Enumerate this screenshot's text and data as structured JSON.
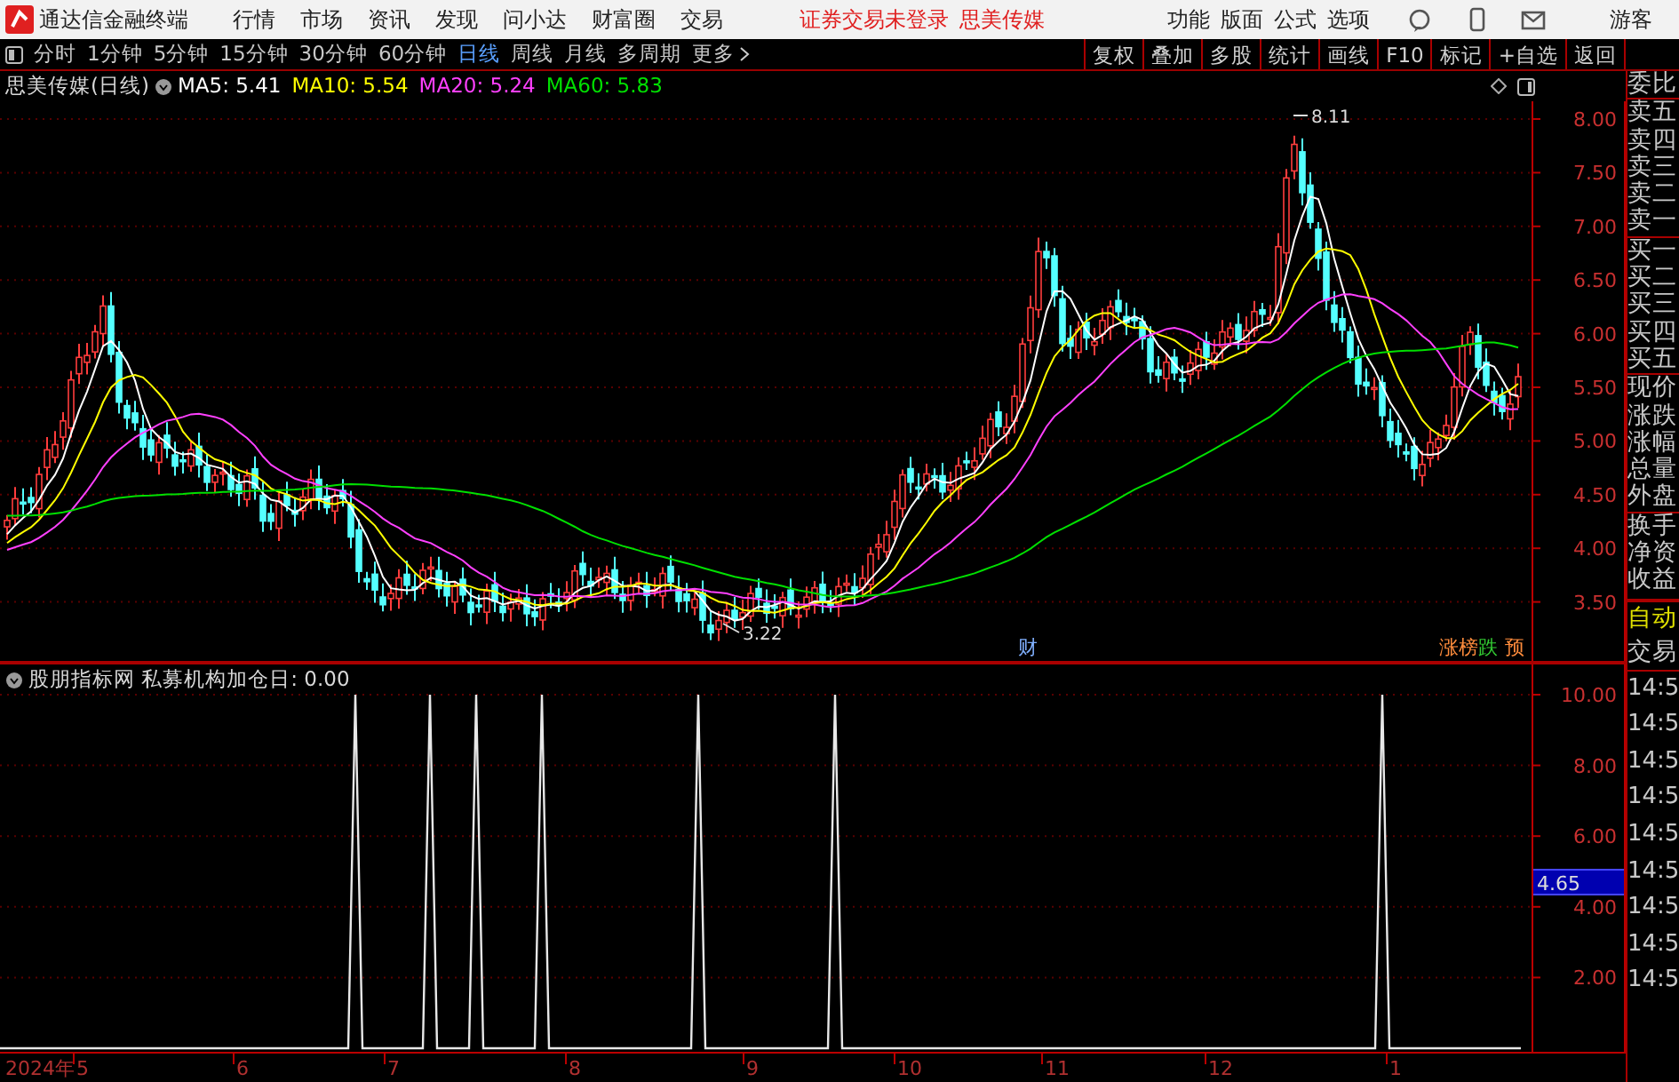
{
  "title_bar": {
    "app_name": "通达信金融终端",
    "menus": [
      "行情",
      "市场",
      "资讯",
      "发现",
      "问小达",
      "财富圈",
      "交易"
    ],
    "login_status": "证券交易未登录",
    "stock_name": "思美传媒",
    "tools": [
      "功能",
      "版面",
      "公式",
      "选项"
    ],
    "user": "游客"
  },
  "toolbar": {
    "periods": [
      {
        "label": "分时",
        "selected": false
      },
      {
        "label": "1分钟",
        "selected": false
      },
      {
        "label": "5分钟",
        "selected": false
      },
      {
        "label": "15分钟",
        "selected": false
      },
      {
        "label": "30分钟",
        "selected": false
      },
      {
        "label": "60分钟",
        "selected": false
      },
      {
        "label": "日线",
        "selected": true
      },
      {
        "label": "周线",
        "selected": false
      },
      {
        "label": "月线",
        "selected": false
      },
      {
        "label": "多周期",
        "selected": false
      }
    ],
    "more": "更多",
    "buttons": [
      "复权",
      "叠加",
      "多股",
      "统计",
      "画线",
      "F10",
      "标记",
      "+自选",
      "返回"
    ]
  },
  "price_chart": {
    "title": "思美传媒(日线)",
    "ma": [
      {
        "label": "MA5: 5.41",
        "color": "#ffffff"
      },
      {
        "label": "MA10: 5.54",
        "color": "#ffff00"
      },
      {
        "label": "MA20: 5.24",
        "color": "#ff40ff"
      },
      {
        "label": "MA60: 5.83",
        "color": "#00e000"
      }
    ],
    "high_label": "8.11",
    "low_label": "3.22",
    "yticks": [
      "8.00",
      "7.50",
      "7.00",
      "6.50",
      "6.00",
      "5.50",
      "5.00",
      "4.50",
      "4.00",
      "3.50"
    ],
    "tags": [
      {
        "text": "财",
        "color": "#80b0ff"
      },
      {
        "text": "涨榜",
        "color": "#ff8c3c"
      },
      {
        "text": "跌",
        "color": "#33cc33"
      },
      {
        "text": "预",
        "color": "#ff8c3c"
      }
    ]
  },
  "indicator": {
    "title": "股朋指标网 私募机构加仓日: 0.00",
    "yticks": [
      "10.00",
      "8.00",
      "6.00",
      "4.00",
      "2.00"
    ],
    "cursor_value": "4.65"
  },
  "date_axis": [
    "2024年",
    "5",
    "6",
    "7",
    "8",
    "9",
    "10",
    "11",
    "12",
    "1"
  ],
  "side_panel": {
    "quote_labels": [
      "委比",
      "卖五",
      "卖四",
      "卖三",
      "卖二",
      "卖一",
      "买一",
      "买二",
      "买三",
      "买四",
      "买五",
      "现价",
      "涨跌",
      "涨幅",
      "总量",
      "外盘",
      "换手",
      "净资",
      "收益"
    ],
    "auto": "自动",
    "trade": "交易",
    "times": [
      "14:5",
      "14:5",
      "14:5",
      "14:5",
      "14:5",
      "14:5",
      "14:5",
      "14:5",
      "14:5"
    ]
  }
}
